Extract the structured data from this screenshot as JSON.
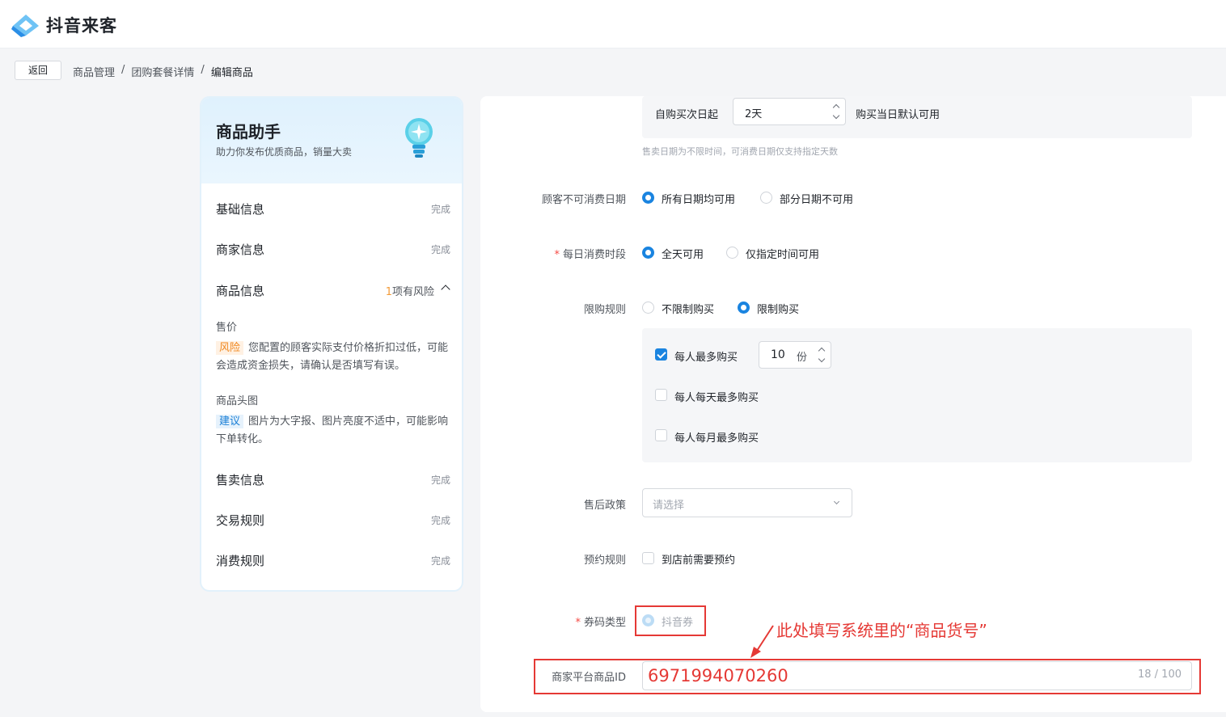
{
  "app": {
    "name": "抖音来客"
  },
  "nav": {
    "back_label": "返回",
    "breadcrumb": [
      "商品管理",
      "团购套餐详情",
      "编辑商品"
    ],
    "separator": "/"
  },
  "assistant": {
    "title": "商品助手",
    "subtitle": "助力你发布优质商品，销量大卖",
    "steps": [
      {
        "name": "基础信息",
        "status": "完成"
      },
      {
        "name": "商家信息",
        "status": "完成"
      },
      {
        "name": "商品信息",
        "risk_count": "1",
        "risk_text": "项有风险"
      },
      {
        "name": "售卖信息",
        "status": "完成"
      },
      {
        "name": "交易规则",
        "status": "完成"
      },
      {
        "name": "消费规则",
        "status": "完成"
      }
    ],
    "issues": [
      {
        "title": "售价",
        "tag": "风险",
        "text": "您配置的顾客实际支付价格折扣过低，可能会造成资金损失，请确认是否填写有误。"
      },
      {
        "title": "商品头图",
        "tag": "建议",
        "text": "图片为大字报、图片亮度不适中，可能影响下单转化。"
      }
    ]
  },
  "form": {
    "validity": {
      "prefix": "自购买次日起",
      "value": "2天",
      "suffix": "购买当日默认可用",
      "hint": "售卖日期为不限时间，可消费日期仅支持指定天数"
    },
    "unavailable_dates": {
      "label": "顾客不可消费日期",
      "options": [
        "所有日期均可用",
        "部分日期不可用"
      ],
      "selected": 0
    },
    "daily_period": {
      "label": "每日消费时段",
      "required": true,
      "options": [
        "全天可用",
        "仅指定时间可用"
      ],
      "selected": 0
    },
    "purchase_limit": {
      "label": "限购规则",
      "options": [
        "不限制购买",
        "限制购买"
      ],
      "selected": 1,
      "per_person": {
        "label": "每人最多购买",
        "checked": true,
        "value": "10",
        "unit": "份"
      },
      "per_day": {
        "label": "每人每天最多购买",
        "checked": false
      },
      "per_month": {
        "label": "每人每月最多购买",
        "checked": false
      }
    },
    "after_sale": {
      "label": "售后政策",
      "placeholder": "请选择"
    },
    "reservation": {
      "label": "预约规则",
      "option": "到店前需要预约",
      "checked": false
    },
    "code_type": {
      "label": "券码类型",
      "required": true,
      "option": "抖音券",
      "disabled": true
    },
    "merchant_id": {
      "label": "商家平台商品ID",
      "value": "6971994070260",
      "counter": "18 / 100"
    }
  },
  "annotation": {
    "text": "此处填写系统里的“商品货号”",
    "color": "#e53935"
  },
  "colors": {
    "primary": "#1a84e0",
    "risk": "#f08a24",
    "required": "#f54a45"
  }
}
